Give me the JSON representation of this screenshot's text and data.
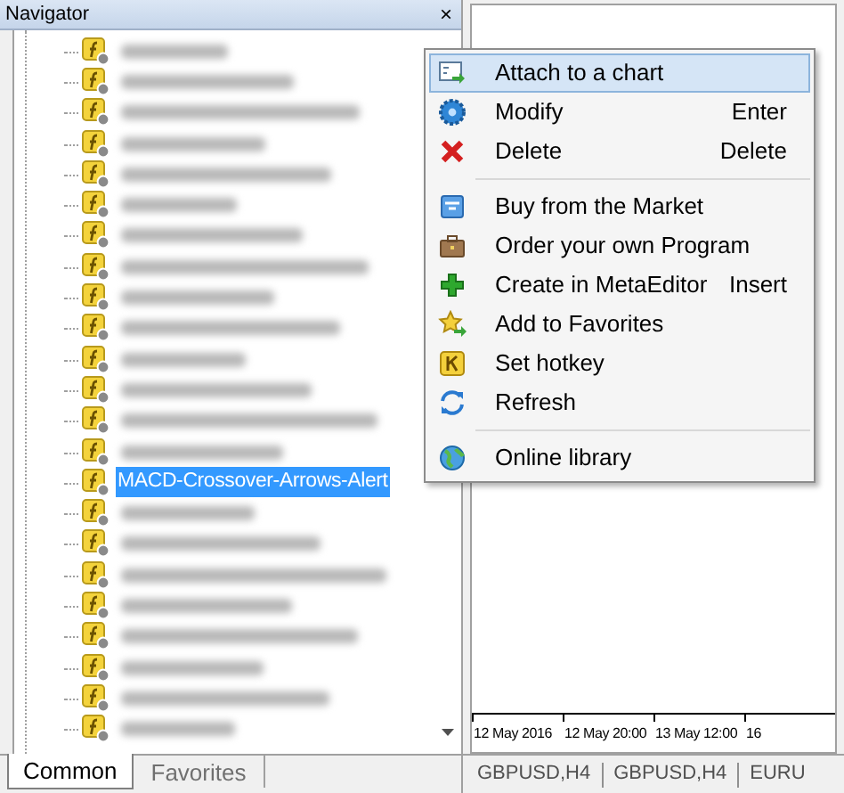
{
  "navigator": {
    "title": "Navigator",
    "close": "×",
    "tree": [
      {
        "kind": "blurred",
        "selected": false
      },
      {
        "kind": "blurred",
        "selected": false
      },
      {
        "kind": "blurred",
        "selected": false
      },
      {
        "kind": "blurred",
        "selected": false
      },
      {
        "kind": "blurred",
        "selected": false
      },
      {
        "kind": "blurred",
        "selected": false
      },
      {
        "kind": "blurred",
        "selected": false
      },
      {
        "kind": "blurred",
        "selected": false
      },
      {
        "kind": "blurred",
        "selected": false
      },
      {
        "kind": "blurred",
        "selected": false
      },
      {
        "kind": "blurred",
        "selected": false
      },
      {
        "kind": "blurred",
        "selected": false
      },
      {
        "kind": "blurred",
        "selected": false
      },
      {
        "kind": "blurred",
        "selected": false
      },
      {
        "kind": "named",
        "label": "MACD-Crossover-Arrows-Alert",
        "selected": true
      },
      {
        "kind": "blurred",
        "selected": false
      },
      {
        "kind": "blurred",
        "selected": false
      },
      {
        "kind": "blurred",
        "selected": false
      },
      {
        "kind": "blurred",
        "selected": false
      },
      {
        "kind": "blurred",
        "selected": false
      },
      {
        "kind": "blurred",
        "selected": false
      },
      {
        "kind": "blurred",
        "selected": false
      },
      {
        "kind": "blurred",
        "selected": false
      }
    ],
    "tabs": [
      {
        "label": "Common",
        "selected": true
      },
      {
        "label": "Favorites",
        "selected": false
      }
    ]
  },
  "context_menu": [
    {
      "kind": "item",
      "label": "Attach to a chart",
      "selected": true
    },
    {
      "kind": "item",
      "label": "Modify",
      "shortcut": "Enter",
      "selected": false
    },
    {
      "kind": "item",
      "label": "Delete",
      "shortcut": "Delete",
      "selected": false
    },
    {
      "kind": "separator"
    },
    {
      "kind": "item",
      "label": "Buy from the Market",
      "selected": false
    },
    {
      "kind": "item",
      "label": "Order your own Program",
      "selected": false
    },
    {
      "kind": "item",
      "label": "Create in MetaEditor",
      "shortcut": "Insert",
      "selected": false
    },
    {
      "kind": "item",
      "label": "Add to Favorites",
      "selected": false
    },
    {
      "kind": "item",
      "label": "Set hotkey",
      "selected": false
    },
    {
      "kind": "item",
      "label": "Refresh",
      "selected": false
    },
    {
      "kind": "separator"
    },
    {
      "kind": "item",
      "label": "Online library",
      "selected": false
    }
  ],
  "chart": {
    "time_axis": [
      "12 May 2016",
      "12 May 20:00",
      "13 May 12:00",
      "16"
    ]
  },
  "chart_tabs": [
    "GBPUSD,H4",
    "GBPUSD,H4",
    "EURU"
  ]
}
